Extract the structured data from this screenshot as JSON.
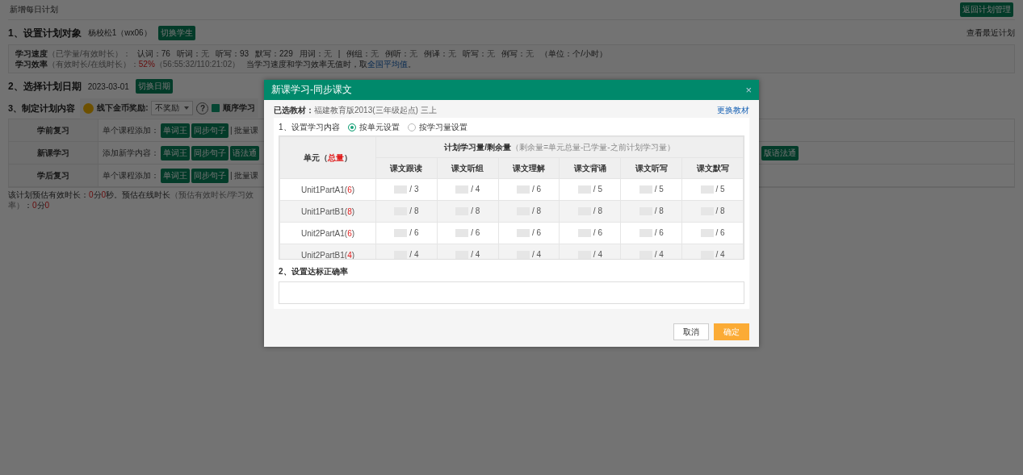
{
  "page": {
    "title": "新增每日计划",
    "back_button": "返回计划管理"
  },
  "target": {
    "heading": "1、设置计划对象",
    "student": "杨校松1（wx06）",
    "switch_button": "切换学生",
    "recent_link": "查看最近计划"
  },
  "stats": {
    "speed_label": "学习速度",
    "speed_hint": "（已学量/有效时长）：",
    "speed_groups": [
      [
        {
          "label": "认词：",
          "value": "76",
          "muted": false
        },
        {
          "label": "听词：",
          "value": "无",
          "muted": true
        },
        {
          "label": "听写：",
          "value": "93",
          "muted": false
        },
        {
          "label": "默写：",
          "value": "229",
          "muted": false
        },
        {
          "label": "用词：",
          "value": "无",
          "muted": true
        }
      ],
      [
        {
          "label": "例组：",
          "value": "无",
          "muted": true
        },
        {
          "label": "例听：",
          "value": "无",
          "muted": true
        },
        {
          "label": "例译：",
          "value": "无",
          "muted": true
        },
        {
          "label": "听写：",
          "value": "无",
          "muted": true
        },
        {
          "label": "例写：",
          "value": "无",
          "muted": true
        }
      ]
    ],
    "separator": "|",
    "unit_note": "（单位：个/小时）",
    "efficiency_label": "学习效率",
    "efficiency_hint": "（有效时长/在线时长）：",
    "efficiency_value": "52%",
    "efficiency_detail": "（56:55:32/110:21:02）",
    "note": "当学习速度和学习效率无值时，取",
    "note_link": "全国平均值",
    "note_end": "。"
  },
  "date": {
    "heading": "2、选择计划日期",
    "date": "2023-03-01",
    "switch_button": "切换日期"
  },
  "content": {
    "heading": "3、制定计划内容",
    "reward_label": "线下金币奖励:",
    "reward_select": "不奖励",
    "help": "?",
    "sequential": {
      "label": "顺序学习",
      "checked": true
    },
    "rows": [
      {
        "name": "学前复习",
        "add_label": "单个课程添加：",
        "buttons": [
          "单词王",
          "同步句子"
        ],
        "separator": "|",
        "batch": "批量课"
      },
      {
        "name": "新课学习",
        "add_label": "添加新学内容：",
        "buttons": [
          "单词王",
          "同步句子",
          "语法通"
        ],
        "far_buttons": [
          "版语法通"
        ]
      },
      {
        "name": "学后复习",
        "add_label": "单个课程添加：",
        "buttons": [
          "单词王",
          "同步句子"
        ],
        "separator": "|",
        "batch": "批量课"
      }
    ]
  },
  "estimate": [
    {
      "text": "该计划预估有效时长：",
      "highlight": false
    },
    {
      "text": "0",
      "highlight": true
    },
    {
      "text": "分",
      "highlight": false
    },
    {
      "text": "0",
      "highlight": true
    },
    {
      "text": "秒。预估在线时长",
      "highlight": false
    },
    {
      "text": "（预估有效时长/学习效率）",
      "highlight": false,
      "muted": true
    },
    {
      "text": "：",
      "highlight": false
    },
    {
      "text": "0",
      "highlight": true
    },
    {
      "text": "分",
      "highlight": false
    },
    {
      "text": "0",
      "highlight": true
    }
  ],
  "dialog": {
    "title": "新课学习-同步课文",
    "close": "×",
    "textbook_label": "已选教材：",
    "textbook": "福建教育版2013(三年级起点) 三上",
    "change_link": "更换教材",
    "content_heading": "1、设置学习内容",
    "modes": [
      {
        "label": "按单元设置",
        "selected": true
      },
      {
        "label": "按学习量设置",
        "selected": false
      }
    ],
    "table": {
      "unit_header": "单元（**总量**）",
      "plan_header": "计划学习量/剩余量",
      "plan_note": "（剩余量=单元总量-已学量-之前计划学习量）",
      "columns": [
        "课文跟读",
        "课文听组",
        "课文理解",
        "课文背诵",
        "课文听写",
        "课文默写"
      ],
      "rows": [
        {
          "unit": "Unit1PartA1(**6**)",
          "remaining": [
            "/ 3",
            "/ 4",
            "/ 6",
            "/ 5",
            "/ 5",
            "/ 5"
          ]
        },
        {
          "unit": "Unit1PartB1(**8**)",
          "remaining": [
            "/ 8",
            "/ 8",
            "/ 8",
            "/ 8",
            "/ 8",
            "/ 8"
          ]
        },
        {
          "unit": "Unit2PartA1(**6**)",
          "remaining": [
            "/ 6",
            "/ 6",
            "/ 6",
            "/ 6",
            "/ 6",
            "/ 6"
          ]
        },
        {
          "unit": "Unit2PartB1(**4**)",
          "remaining": [
            "/ 4",
            "/ 4",
            "/ 4",
            "/ 4",
            "/ 4",
            "/ 4"
          ]
        }
      ]
    },
    "accuracy_heading": "2、设置达标正确率",
    "buttons": [
      {
        "label": "取消",
        "kind": "secondary"
      },
      {
        "label": "确定",
        "kind": "primary"
      }
    ]
  }
}
